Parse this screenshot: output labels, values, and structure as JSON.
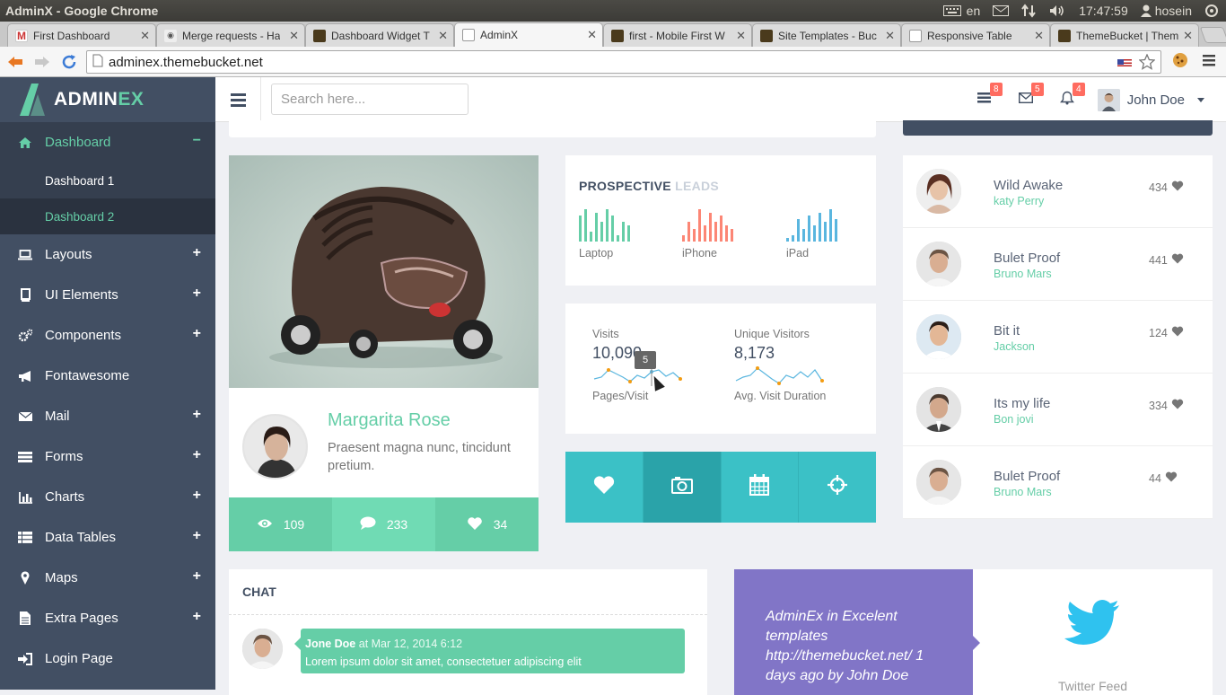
{
  "os": {
    "window_title": "AdminX - Google Chrome",
    "keyboard_lang": "en",
    "time": "17:47:59",
    "username": "hosein"
  },
  "browser": {
    "tabs": [
      {
        "label": "First Dashboard",
        "active": false
      },
      {
        "label": "Merge requests - Ha",
        "active": false
      },
      {
        "label": "Dashboard Widget T",
        "active": false
      },
      {
        "label": "AdminX",
        "active": true
      },
      {
        "label": "first - Mobile First W",
        "active": false
      },
      {
        "label": "Site Templates - Buc",
        "active": false
      },
      {
        "label": "Responsive Table",
        "active": false
      },
      {
        "label": "ThemeBucket | Them",
        "active": false
      }
    ],
    "url": "adminex.themebucket.net"
  },
  "brand": {
    "name_main": "ADMIN",
    "name_accent": "EX",
    "accent_color": "#65cea7",
    "sidebar_color": "#424f63"
  },
  "sidebar": {
    "items": [
      {
        "label": "Dashboard",
        "icon": "home-icon",
        "toggle": "−",
        "active": true
      },
      {
        "label": "Layouts",
        "icon": "laptop-icon",
        "toggle": "+"
      },
      {
        "label": "UI Elements",
        "icon": "book-icon",
        "toggle": "+"
      },
      {
        "label": "Components",
        "icon": "cogs-icon",
        "toggle": "+"
      },
      {
        "label": "Fontawesome",
        "icon": "bullhorn-icon",
        "toggle": ""
      },
      {
        "label": "Mail",
        "icon": "envelope-icon",
        "toggle": "+"
      },
      {
        "label": "Forms",
        "icon": "tasks-icon",
        "toggle": "+"
      },
      {
        "label": "Charts",
        "icon": "bar-chart-icon",
        "toggle": "+"
      },
      {
        "label": "Data Tables",
        "icon": "th-list-icon",
        "toggle": "+"
      },
      {
        "label": "Maps",
        "icon": "map-marker-icon",
        "toggle": "+"
      },
      {
        "label": "Extra Pages",
        "icon": "file-icon",
        "toggle": "+"
      },
      {
        "label": "Login Page",
        "icon": "sign-in-icon",
        "toggle": ""
      }
    ],
    "sub_items": [
      {
        "label": "Dashboard 1",
        "active": false
      },
      {
        "label": "Dashboard 2",
        "active": true
      }
    ]
  },
  "header": {
    "search_placeholder": "Search here...",
    "notifications": [
      {
        "icon": "tasks-icon",
        "count": "8"
      },
      {
        "icon": "envelope-icon",
        "count": "5"
      },
      {
        "icon": "bell-icon",
        "count": "4"
      }
    ],
    "user_name": "John Doe"
  },
  "profile": {
    "name": "Margarita Rose",
    "description": "Praesent magna nunc, tincidunt pretium.",
    "stats": [
      {
        "icon": "eye-icon",
        "value": "109"
      },
      {
        "icon": "comment-icon",
        "value": "233"
      },
      {
        "icon": "heart-icon",
        "value": "34"
      }
    ]
  },
  "leads": {
    "title_main": "PROSPECTIVE",
    "title_muted": "LEADS",
    "devices": [
      {
        "label": "Laptop",
        "color": "#65cea7",
        "values": [
          8,
          10,
          3,
          9,
          6,
          10,
          8,
          2,
          6,
          5
        ]
      },
      {
        "label": "iPhone",
        "color": "#fc8675",
        "values": [
          2,
          6,
          4,
          10,
          5,
          9,
          6,
          8,
          5,
          4
        ]
      },
      {
        "label": "iPad",
        "color": "#5ab6df",
        "values": [
          1,
          2,
          7,
          4,
          8,
          5,
          9,
          6,
          10,
          7
        ]
      }
    ]
  },
  "visits": {
    "visits_label": "Visits",
    "visits_value": "10,090",
    "visits_sub": "Pages/Visit",
    "unique_label": "Unique Visitors",
    "unique_value": "8,173",
    "unique_sub": "Avg. Visit Duration",
    "tooltip": "5"
  },
  "tiles": [
    {
      "icon": "heart-icon"
    },
    {
      "icon": "camera-icon"
    },
    {
      "icon": "calendar-icon"
    },
    {
      "icon": "crosshairs-icon"
    }
  ],
  "songs": [
    {
      "title": "Wild Awake",
      "artist": "katy Perry",
      "likes": "434"
    },
    {
      "title": "Bulet Proof",
      "artist": "Bruno Mars",
      "likes": "441"
    },
    {
      "title": "Bit it",
      "artist": "Jackson",
      "likes": "124"
    },
    {
      "title": "Its my life",
      "artist": "Bon jovi",
      "likes": "334"
    },
    {
      "title": "Bulet Proof",
      "artist": "Bruno Mars",
      "likes": "44"
    }
  ],
  "chat": {
    "title": "CHAT",
    "message": {
      "author": "Jone Doe",
      "meta": "at Mar 12, 2014 6:12",
      "text": "Lorem ipsum dolor sit amet, consectetuer adipiscing elit"
    }
  },
  "twitter": {
    "text_before": "AdminEx in Excelent templates",
    "link": "http://themebucket.net/",
    "text_after": "1 days ago by John Doe",
    "feed_label": "Twitter Feed"
  }
}
